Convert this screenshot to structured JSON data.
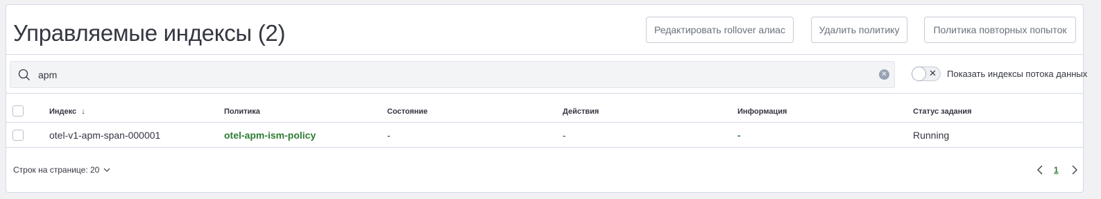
{
  "header": {
    "title": "Управляемые индексы (2)",
    "buttons": {
      "edit_rollover": "Редактировать rollover алиас",
      "delete_policy": "Удалить политику",
      "retry_policy": "Политика повторных попыток"
    }
  },
  "search": {
    "value": "apm",
    "icon": "search-icon",
    "clear_icon": "clear-icon"
  },
  "toggle": {
    "label": "Показать индексы потока данных",
    "checked": false
  },
  "table": {
    "columns": [
      "Индекс",
      "Политика",
      "Состояние",
      "Действия",
      "Информация",
      "Статус задания"
    ],
    "sort_indicator": "↓",
    "rows": [
      {
        "index": "otel-v1-apm-span-000001",
        "policy": "otel-apm-ism-policy",
        "state": "-",
        "action": "-",
        "info": "-",
        "job_status": "Running"
      }
    ]
  },
  "pagination": {
    "rows_per_page": "Строк на странице: 20",
    "current_page": "1"
  },
  "colors": {
    "accent": "#2d7d32",
    "border": "#d3dae6",
    "text": "#343741"
  }
}
